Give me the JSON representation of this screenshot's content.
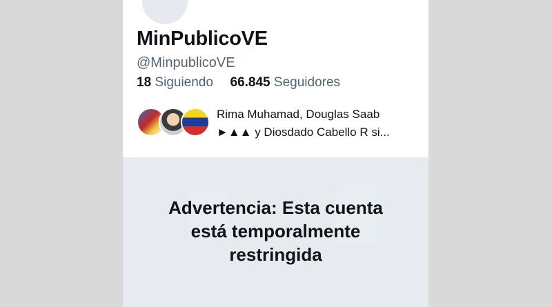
{
  "profile": {
    "display_name": "MinPublicoVE",
    "handle": "@MinpublicoVE",
    "following_count": "18",
    "following_label": "Siguiendo",
    "followers_count": "66.845",
    "followers_label": "Seguidores"
  },
  "followers_you_know": {
    "line1": "Rima Muhamad, Douglas Saab",
    "line2": "►▲▲ y Diosdado Cabello R si..."
  },
  "warning": {
    "title": "Advertencia: Esta cuenta está temporalmente restringida"
  }
}
